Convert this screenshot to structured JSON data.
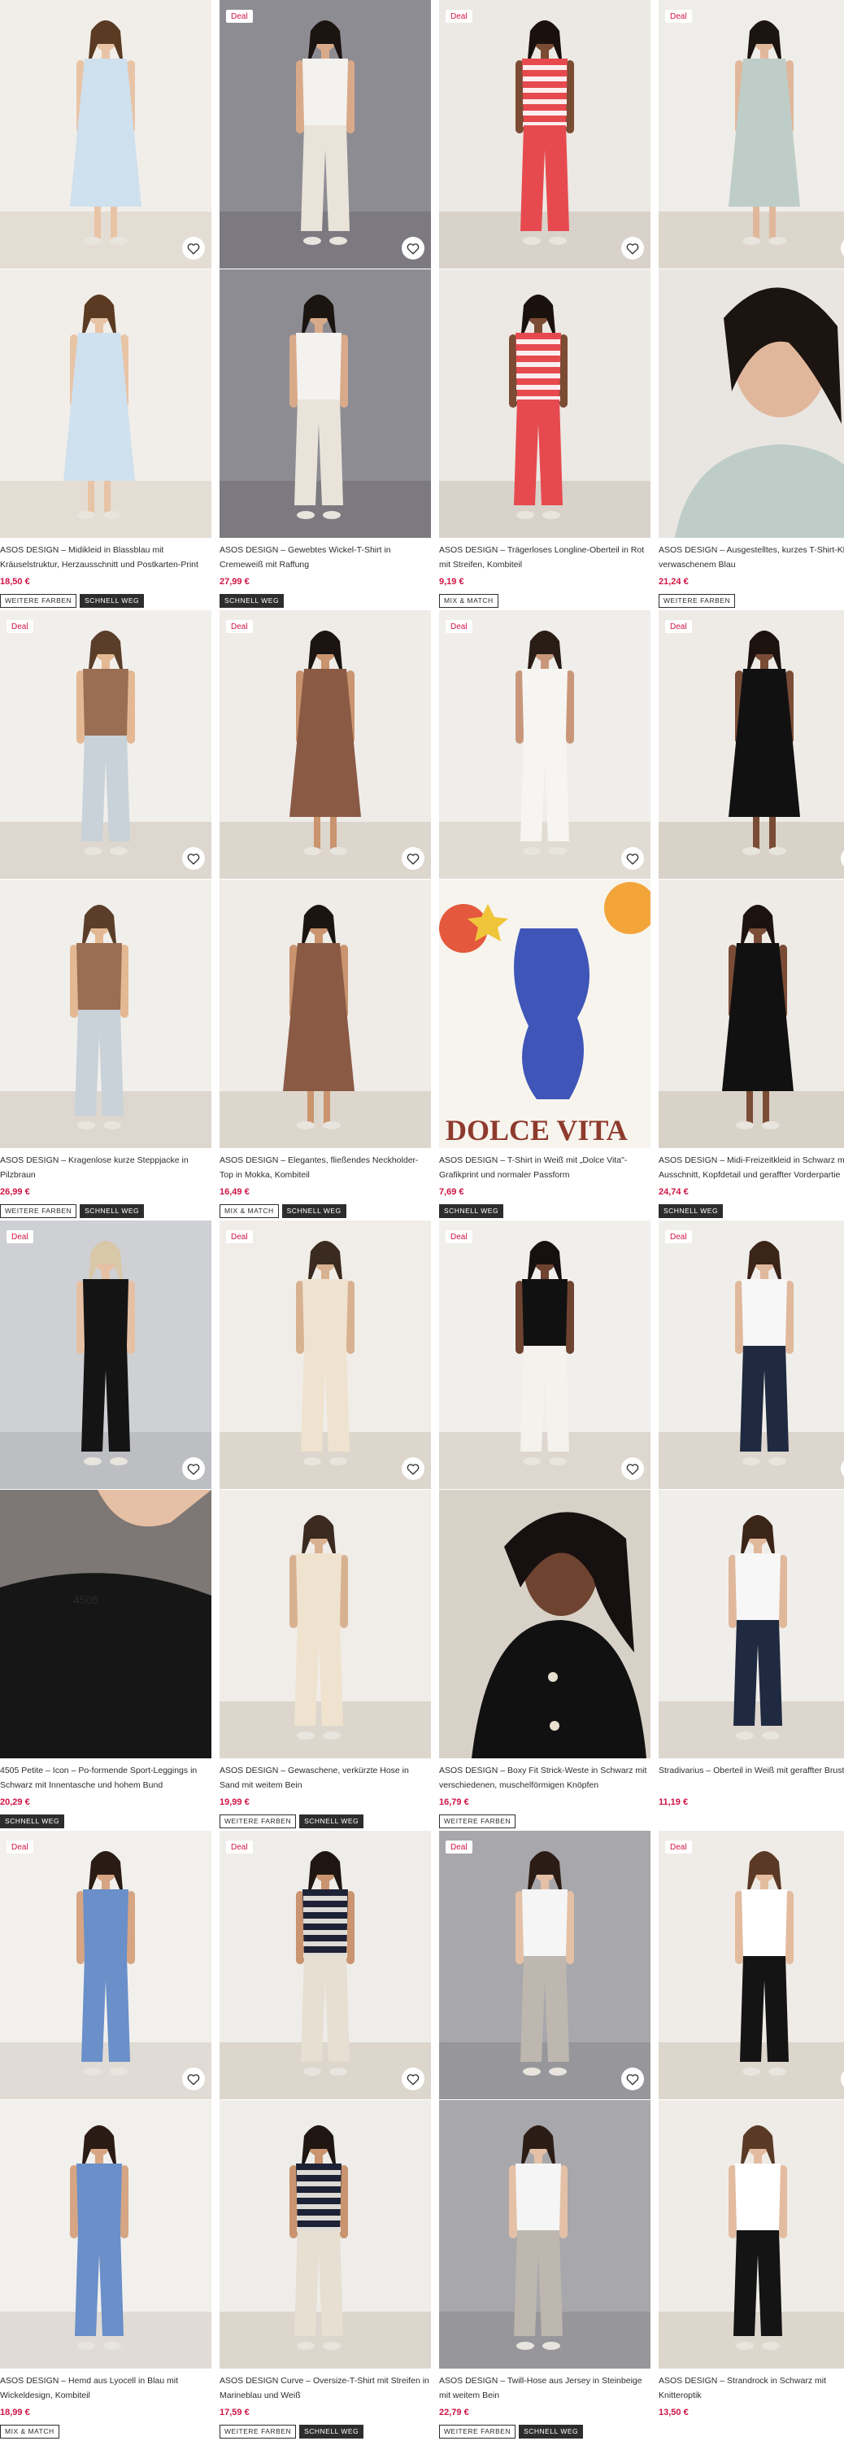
{
  "labels": {
    "deal": "Deal"
  },
  "colors": {
    "price": "#d01345",
    "badge_dark": "#2d2d2d"
  },
  "products": [
    {
      "title": "ASOS DESIGN – Midikleid in Blassblau mit Kräuselstruktur, Herzausschnitt und Postkarten-Print",
      "price": "18,50 €",
      "deal": false,
      "badges": [
        {
          "text": "WEITERE FARBEN",
          "dark": false
        },
        {
          "text": "SCHNELL WEG",
          "dark": true
        }
      ]
    },
    {
      "title": "ASOS DESIGN – Gewebtes Wickel-T-Shirt in Cremeweiß mit Raffung",
      "price": "27,99 €",
      "deal": true,
      "badges": [
        {
          "text": "SCHNELL WEG",
          "dark": true
        }
      ]
    },
    {
      "title": "ASOS DESIGN – Trägerloses Longline-Oberteil in Rot mit Streifen, Kombiteil",
      "price": "9,19 €",
      "deal": true,
      "badges": [
        {
          "text": "MIX & MATCH",
          "dark": false
        }
      ]
    },
    {
      "title": "ASOS DESIGN – Ausgestelltes, kurzes T-Shirt-Kleid in verwaschenem Blau",
      "price": "21,24 €",
      "deal": true,
      "badges": [
        {
          "text": "WEITERE FARBEN",
          "dark": false
        }
      ]
    },
    {
      "title": "ASOS DESIGN – Kragenlose kurze Steppjacke in Pilzbraun",
      "price": "26,99 €",
      "deal": true,
      "badges": [
        {
          "text": "WEITERE FARBEN",
          "dark": false
        },
        {
          "text": "SCHNELL WEG",
          "dark": true
        }
      ]
    },
    {
      "title": "ASOS DESIGN – Elegantes, fließendes Neckholder-Top in Mokka, Kombiteil",
      "price": "16,49 €",
      "deal": true,
      "badges": [
        {
          "text": "MIX & MATCH",
          "dark": false
        },
        {
          "text": "SCHNELL WEG",
          "dark": true
        }
      ]
    },
    {
      "title": "ASOS DESIGN – T-Shirt in Weiß mit „Dolce Vita\"-Grafikprint und normaler Passform",
      "price": "7,69 €",
      "deal": true,
      "badges": [
        {
          "text": "SCHNELL WEG",
          "dark": true
        }
      ]
    },
    {
      "title": "ASOS DESIGN – Midi-Freizeitkleid in Schwarz mit V-Ausschnitt, Kopfdetail und geraffter Vorderpartie",
      "price": "24,74 €",
      "deal": true,
      "badges": [
        {
          "text": "SCHNELL WEG",
          "dark": true
        }
      ]
    },
    {
      "title": "4505 Petite – Icon – Po-formende Sport-Leggings in Schwarz mit Innentasche und hohem Bund",
      "price": "20,29 €",
      "deal": true,
      "badges": [
        {
          "text": "SCHNELL WEG",
          "dark": true
        }
      ]
    },
    {
      "title": "ASOS DESIGN – Gewaschene, verkürzte Hose in Sand mit weitem Bein",
      "price": "19,99 €",
      "deal": true,
      "badges": [
        {
          "text": "WEITERE FARBEN",
          "dark": false
        },
        {
          "text": "SCHNELL WEG",
          "dark": true
        }
      ]
    },
    {
      "title": "ASOS DESIGN – Boxy Fit Strick-Weste in Schwarz mit verschiedenen, muschelförmigen Knöpfen",
      "price": "16,79 €",
      "deal": true,
      "badges": [
        {
          "text": "WEITERE FARBEN",
          "dark": false
        }
      ]
    },
    {
      "title": "Stradivarius – Oberteil in Weiß mit geraffter Brustpartie",
      "price": "11,19 €",
      "deal": true,
      "badges": []
    },
    {
      "title": "ASOS DESIGN – Hemd aus Lyocell in Blau mit Wickeldesign, Kombiteil",
      "price": "18,99 €",
      "deal": true,
      "badges": [
        {
          "text": "MIX & MATCH",
          "dark": false
        }
      ]
    },
    {
      "title": "ASOS DESIGN Curve – Oversize-T-Shirt mit Streifen in Marineblau und Weiß",
      "price": "17,59 €",
      "deal": true,
      "badges": [
        {
          "text": "WEITERE FARBEN",
          "dark": false
        },
        {
          "text": "SCHNELL WEG",
          "dark": true
        }
      ]
    },
    {
      "title": "ASOS DESIGN – Twill-Hose aus Jersey in Steinbeige mit weitem Bein",
      "price": "22,79 €",
      "deal": true,
      "badges": [
        {
          "text": "WEITERE FARBEN",
          "dark": false
        },
        {
          "text": "SCHNELL WEG",
          "dark": true
        }
      ]
    },
    {
      "title": "ASOS DESIGN – Strandrock in Schwarz mit Knitteroptik",
      "price": "13,50 €",
      "deal": true,
      "badges": []
    }
  ]
}
